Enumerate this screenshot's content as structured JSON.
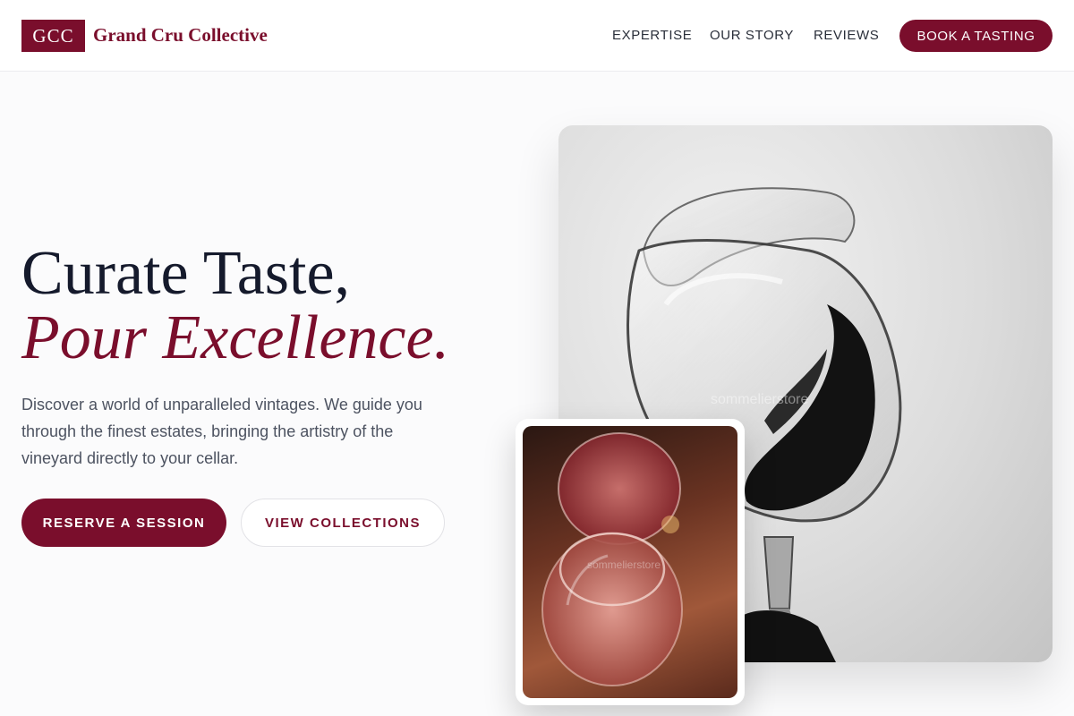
{
  "brand": {
    "logo_initials": "GCC",
    "name": "Grand Cru Collective",
    "color": "#7a0e2c"
  },
  "nav": {
    "links": [
      "EXPERTISE",
      "OUR STORY",
      "REVIEWS"
    ],
    "cta": "BOOK A TASTING"
  },
  "hero": {
    "headline_line1": "Curate Taste,",
    "headline_line2": "Pour Excellence.",
    "description": "Discover a world of unparalleled vintages. We guide you through the finest estates, bringing the artistry of the vineyard directly to your cellar.",
    "primary_button": "RESERVE A SESSION",
    "secondary_button": "VIEW COLLECTIONS"
  },
  "images": {
    "main_watermark": "sommelierstore",
    "small_watermark": "sommelierstore"
  }
}
